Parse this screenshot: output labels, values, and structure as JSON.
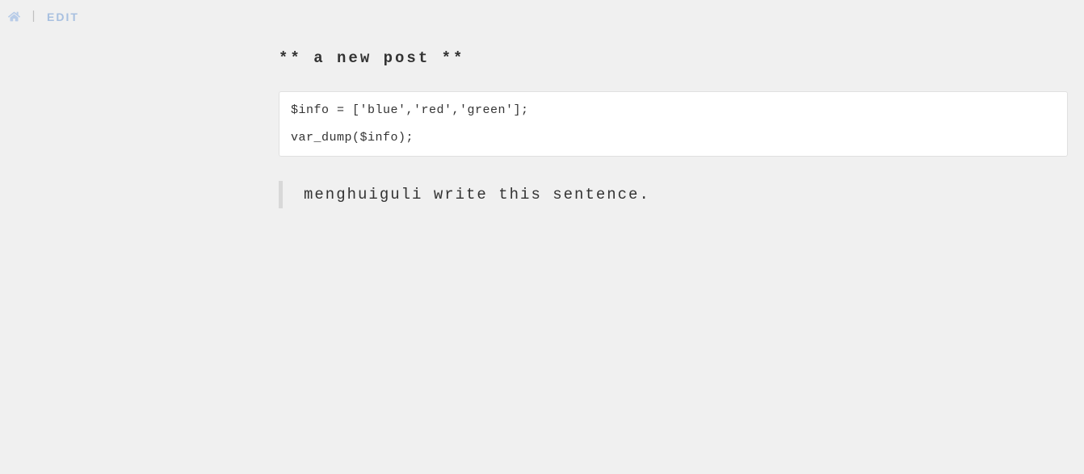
{
  "header": {
    "divider": "|",
    "edit_label": "EDIT"
  },
  "post": {
    "title": "** a new post **",
    "code": "$info = ['blue','red','green'];\n\nvar_dump($info);",
    "quote": "menghuiguli write this sentence."
  }
}
